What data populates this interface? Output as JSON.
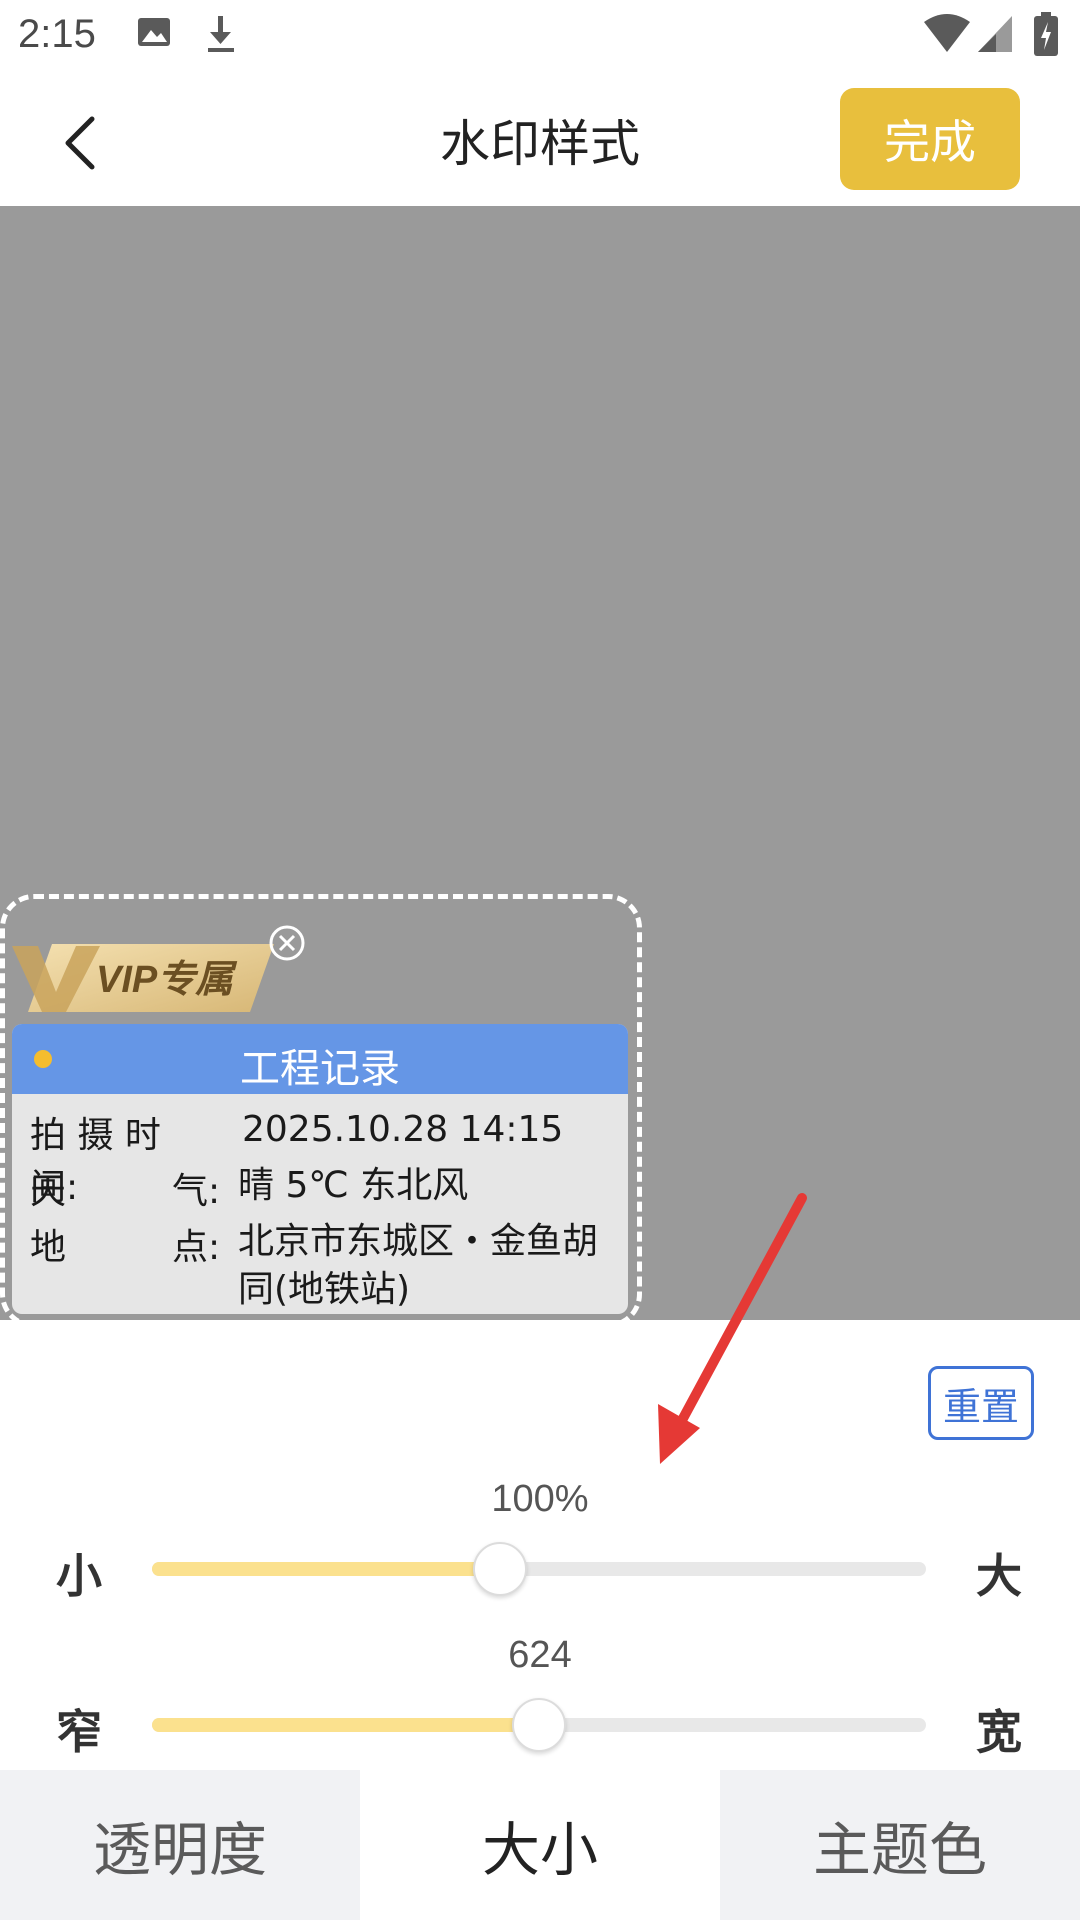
{
  "status_bar": {
    "time": "2:15",
    "icons": [
      "image-icon",
      "download-icon",
      "wifi-icon",
      "signal-icon",
      "battery-icon"
    ]
  },
  "header": {
    "title": "水印样式",
    "done_label": "完成",
    "back_icon": "chevron-left-icon"
  },
  "watermark": {
    "vip_label": "VIP专属",
    "card_title": "工程记录",
    "rows": [
      {
        "label": "拍 摄 时 间:",
        "label_tail": "",
        "value": "2025.10.28 14:15"
      },
      {
        "label": "天",
        "label_tail": "气:",
        "value": "晴 5℃ 东北风"
      },
      {
        "label": "地",
        "label_tail": "点:",
        "value": "北京市东城区・金鱼胡同(地铁站)"
      }
    ]
  },
  "controls": {
    "reset_label": "重置",
    "size_slider": {
      "value_text": "100%",
      "min_label": "小",
      "max_label": "大",
      "fraction": 0.45
    },
    "width_slider": {
      "value_text": "624",
      "min_label": "窄",
      "max_label": "宽",
      "fraction": 0.5
    }
  },
  "tabs": [
    {
      "label": "透明度",
      "active": false
    },
    {
      "label": "大小",
      "active": true
    },
    {
      "label": "主题色",
      "active": false
    }
  ],
  "colors": {
    "accent": "#e8bf3d",
    "card_header": "#6596e6",
    "slider_fill": "#fbe18e",
    "annotation_arrow": "#e53935"
  }
}
